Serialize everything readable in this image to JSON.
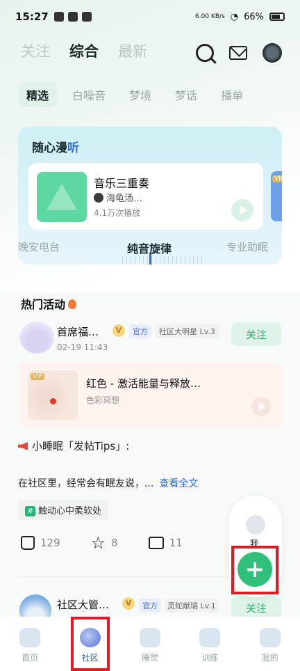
{
  "status_bar": {
    "time": "15:27",
    "net_speed": "6.00 KB/s",
    "battery": "66%"
  },
  "top_tabs": [
    {
      "label": "关注",
      "active": false
    },
    {
      "label": "综合",
      "active": true
    },
    {
      "label": "最新",
      "active": false
    }
  ],
  "sub_tabs": [
    {
      "label": "精选",
      "active": true
    },
    {
      "label": "白噪音",
      "active": false
    },
    {
      "label": "梦境",
      "active": false
    },
    {
      "label": "梦话",
      "active": false
    },
    {
      "label": "播单",
      "active": false
    }
  ],
  "random_listen": {
    "title_a": "随心漫",
    "title_b": "听",
    "track": {
      "name": "音乐三重奏",
      "author": "海龟汤…",
      "plays": "4.1万次播放"
    },
    "peek_vip": "VIP",
    "channels": [
      {
        "label": "晚安电台",
        "active": false
      },
      {
        "label": "纯音旋律",
        "active": true
      },
      {
        "label": "专业助眠",
        "active": false
      }
    ]
  },
  "hot": {
    "title": "热门活动"
  },
  "post1": {
    "username": "首席福…",
    "vbadge": "V",
    "official": "官方",
    "star_tag": "社区大明星 Lv.3",
    "date": "02-19 11:43",
    "follow": "关注",
    "audio": {
      "vip": "VIP",
      "title": "红色 - 激活能量与释放…",
      "subtitle": "色彩冥想"
    },
    "text_line1": "小睡眠「发帖Tips」:",
    "text_line2": "在社区里，经常会有眠友说，...",
    "see_all": "查看全文",
    "topic": "触动心中柔软处",
    "likes": "129",
    "stars": "8",
    "comments": "11"
  },
  "post2": {
    "username": "社区大管…",
    "vbadge": "V",
    "official": "官方",
    "star_tag": "灵蛇献瑞 Lv.1",
    "follow": "关注"
  },
  "float_panel": {
    "label": "我",
    "fab": "+"
  },
  "nav": [
    {
      "label": "首页",
      "active": false
    },
    {
      "label": "社区",
      "active": true
    },
    {
      "label": "睡觉",
      "active": false
    },
    {
      "label": "训练",
      "active": false
    },
    {
      "label": "我的",
      "active": false
    }
  ],
  "colors": {
    "accent": "#31c07a",
    "highlight": "#d81f26",
    "brand_blue": "#2b6bd6"
  }
}
